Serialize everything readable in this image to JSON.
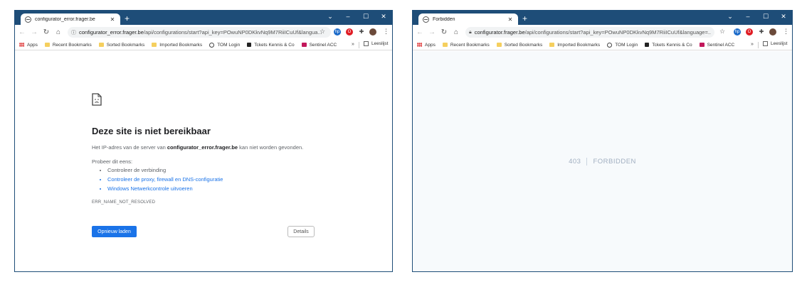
{
  "left_window": {
    "tab_title": "configurator_error.frager.be",
    "tab_close": "✕",
    "new_tab": "+",
    "url_host": "configurator_error.frager.be",
    "url_path": "/api/configurations/start?api_key=POwuNP0DKkvNq9M7RiiICuUf&langua...",
    "bookmarks": [
      "Apps",
      "Recent Bookmarks",
      "Sorted Bookmarks",
      "Imported Bookmarks",
      "TOM Login",
      "Tckets Kennis & Co",
      "Sentinel ACC"
    ],
    "bookmarks_more": "»",
    "reading_list": "Leeslijst",
    "error": {
      "title": "Deze site is niet bereikbaar",
      "desc_before": "Het IP-adres van de server van ",
      "desc_host": "configurator_error.frager.be",
      "desc_after": " kan niet worden gevonden.",
      "try_label": "Probeer dit eens:",
      "suggestions": [
        "Controleer de verbinding",
        "Controleer de proxy, firewall en DNS-configuratie",
        "Windows Netwerkcontrole uitvoeren"
      ],
      "code": "ERR_NAME_NOT_RESOLVED",
      "reload_label": "Opnieuw laden",
      "details_label": "Details"
    }
  },
  "right_window": {
    "tab_title": "Forbidden",
    "tab_close": "✕",
    "new_tab": "+",
    "url_host": "configurator.frager.be",
    "url_path": "/api/configurations/start?api_key=POwuNP0DKkvNq9M7RiiICuUf&language=...",
    "bookmarks": [
      "Apps",
      "Recent Bookmarks",
      "Sorted Bookmarks",
      "Imported Bookmarks",
      "TOM Login",
      "Tckets Kennis & Co",
      "Sentinel ACC"
    ],
    "bookmarks_more": "»",
    "reading_list": "Leeslijst",
    "status_code": "403",
    "status_message": "FORBIDDEN"
  },
  "colors": {
    "titlebar": "#1e4d78",
    "link": "#1a73e8",
    "forbidden_text": "#a0aec0"
  },
  "icons": [
    "back-icon",
    "forward-icon",
    "reload-icon",
    "home-icon",
    "info-icon",
    "lock-icon",
    "star-icon",
    "hp-extension-icon",
    "opera-extension-icon",
    "puzzle-extensions-icon",
    "profile-avatar-icon",
    "menu-kebab-icon",
    "sad-page-icon"
  ]
}
